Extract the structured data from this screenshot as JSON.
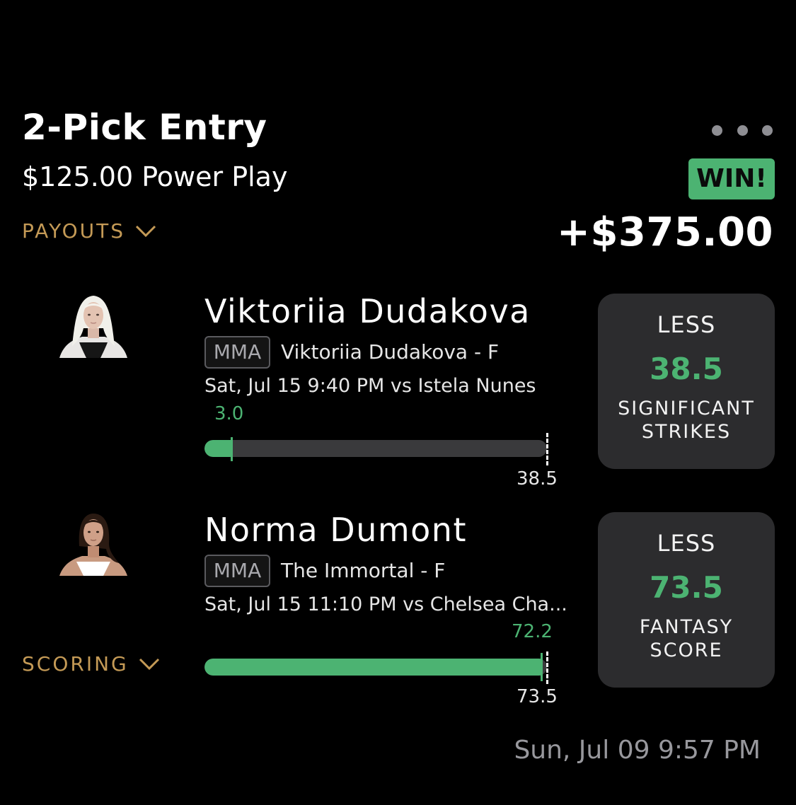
{
  "entry": {
    "title": "2-Pick Entry",
    "subtitle": "$125.00 Power Play",
    "status_badge": "WIN!",
    "amount": "+$375.00",
    "payouts_label": "PAYOUTS",
    "scoring_label": "SCORING",
    "timestamp": "Sun, Jul 09 9:57 PM"
  },
  "colors": {
    "accent_green": "#4cb372",
    "gold": "#c49a56",
    "card_bg": "#2c2c2e"
  },
  "picks": [
    {
      "name": "Viktoriia Dudakova",
      "league": "MMA",
      "detail": "Viktoriia Dudakova - F",
      "game": "Sat, Jul 15 9:40 PM  vs Istela Nunes",
      "current": "3.0",
      "target": "38.5",
      "progress": 0.078,
      "direction": "LESS",
      "line": "38.5",
      "stat_line1": "SIGNIFICANT",
      "stat_line2": "STRIKES"
    },
    {
      "name": "Norma Dumont",
      "league": "MMA",
      "detail": "The Immortal - F",
      "game": "Sat, Jul 15 11:10 PM  vs Chelsea Cha...",
      "current": "72.2",
      "target": "73.5",
      "progress": 0.982,
      "direction": "LESS",
      "line": "73.5",
      "stat_line1": "FANTASY",
      "stat_line2": "SCORE"
    }
  ]
}
